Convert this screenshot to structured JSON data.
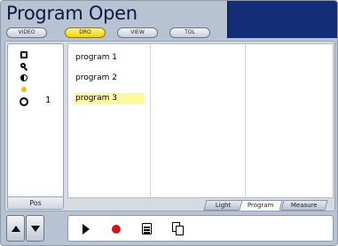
{
  "header": {
    "title": "Program Open",
    "mode_tabs": [
      {
        "label": "VIDEO",
        "active": false
      },
      {
        "label": "DRO",
        "active": true
      },
      {
        "label": "VIEW",
        "active": false
      },
      {
        "label": "TOL",
        "active": false
      }
    ]
  },
  "side_panel": {
    "icons": [
      "camera-box-icon",
      "search-icon",
      "contrast-icon",
      "light-dot-icon",
      "circle-feature-icon"
    ],
    "circle_count": "1",
    "pos_label": "Pos"
  },
  "program_list": {
    "items": [
      {
        "label": "program 1",
        "selected": false
      },
      {
        "label": "program 2",
        "selected": false
      },
      {
        "label": "program 3",
        "selected": true
      }
    ]
  },
  "bottom_tabs": [
    {
      "label": "Light",
      "active": false
    },
    {
      "label": "Program",
      "active": true
    },
    {
      "label": "Measure",
      "active": false
    }
  ],
  "toolbar": {
    "buttons": [
      "up-arrow-icon",
      "down-arrow-icon",
      "play-icon",
      "record-icon",
      "list-icon",
      "copy-icon"
    ]
  },
  "colors": {
    "background": "#b7c3d3",
    "header_display": "#132d76",
    "active_tab": "#f2d200",
    "selection": "#fff9a0",
    "record": "#d0141c"
  }
}
